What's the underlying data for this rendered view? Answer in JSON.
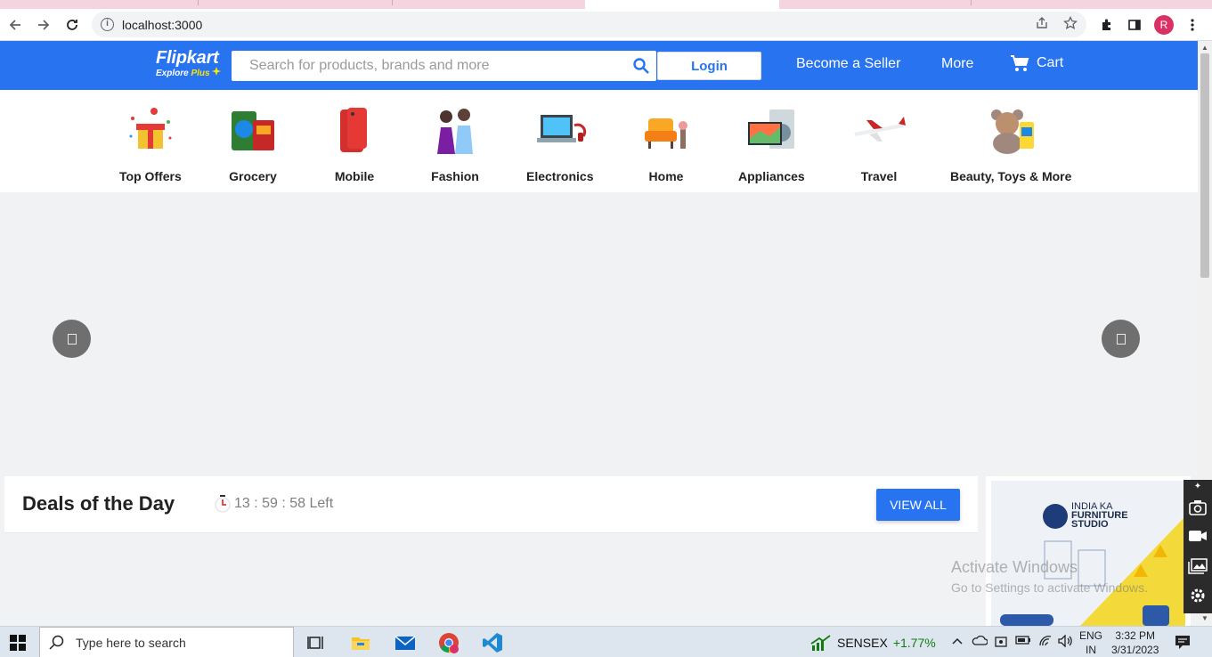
{
  "browser": {
    "url": "localhost:3000",
    "profile_initial": "R"
  },
  "header": {
    "logo_brand": "Flipkart",
    "logo_sub": "Explore",
    "logo_plus": "Plus",
    "search_placeholder": "Search for products, brands and more",
    "login_label": "Login",
    "become_seller": "Become a Seller",
    "more": "More",
    "cart": "Cart",
    "brand_color": "#2874f0"
  },
  "categories": [
    {
      "label": "Top Offers",
      "icon": "gift-icon"
    },
    {
      "label": "Grocery",
      "icon": "grocery-icon"
    },
    {
      "label": "Mobile",
      "icon": "mobile-icon"
    },
    {
      "label": "Fashion",
      "icon": "fashion-icon"
    },
    {
      "label": "Electronics",
      "icon": "laptop-icon"
    },
    {
      "label": "Home",
      "icon": "sofa-icon"
    },
    {
      "label": "Appliances",
      "icon": "appliance-icon"
    },
    {
      "label": "Travel",
      "icon": "airplane-icon"
    },
    {
      "label": "Beauty, Toys & More",
      "icon": "teddy-icon"
    }
  ],
  "deals": {
    "title": "Deals of the Day",
    "timer": "13 : 59 : 58 Left",
    "view_all": "VIEW ALL"
  },
  "ad": {
    "line1": "INDIA KA",
    "line2": "FURNITURE",
    "line3": "STUDIO"
  },
  "watermark": {
    "line1": "Activate Windows",
    "line2": "Go to Settings to activate Windows."
  },
  "taskbar": {
    "search_placeholder": "Type here to search",
    "ticker": "SENSEX",
    "ticker_change": "+1.77%",
    "lang_top": "ENG",
    "lang_bottom": "IN",
    "time": "3:32 PM",
    "date": "3/31/2023"
  }
}
